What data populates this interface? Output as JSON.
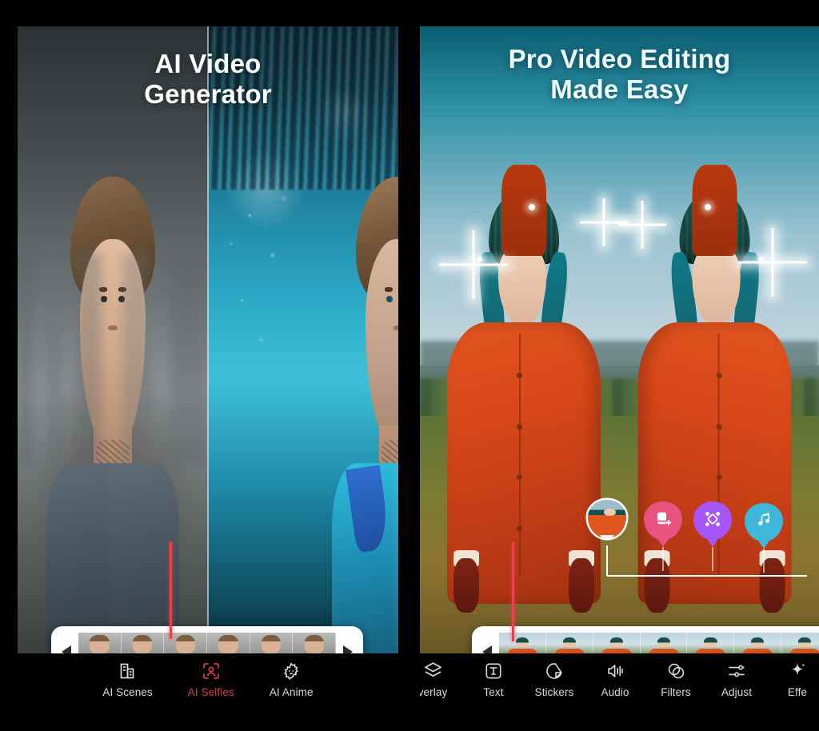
{
  "app": {
    "theme_background": "#000000",
    "accent_active": "#e0384a"
  },
  "left_panel": {
    "headline_line1": "AI Video",
    "headline_line2": "Generator",
    "preview": {
      "split_view": "before-after",
      "before_label": "original",
      "after_label": "ai-enhanced"
    },
    "timeline": {
      "prev_arrow": "◀",
      "next_arrow": "▶",
      "frame_count": 6,
      "playhead_color": "#e8424f"
    },
    "nav": {
      "items": [
        {
          "label": "AI Scenes",
          "icon": "buildings-icon",
          "active": false
        },
        {
          "label": "AI Selfies",
          "icon": "face-scan-icon",
          "active": true
        },
        {
          "label": "AI Anime",
          "icon": "anime-face-icon",
          "active": false
        }
      ]
    }
  },
  "right_panel": {
    "headline_line1": "Pro Video Editing",
    "headline_line2": "Made Easy",
    "preview": {
      "effect": "mirror",
      "subject": "person in orange coat with teal beanie",
      "sparkle_count": 4
    },
    "pins": [
      {
        "name": "clip-thumbnail-pin",
        "icon": "video-thumbnail",
        "color": "#f3f3f3"
      },
      {
        "name": "add-media-pin",
        "icon": "add-image-icon",
        "color": "#e8537f"
      },
      {
        "name": "keyframe-pin",
        "icon": "diamond-nodes-icon",
        "color": "#a855f7"
      },
      {
        "name": "music-pin",
        "icon": "music-notes-icon",
        "color": "#3db8d8"
      }
    ],
    "timeline": {
      "prev_arrow": "◀",
      "frame_count": 7,
      "playhead_color": "#e8424f"
    },
    "nav": {
      "items": [
        {
          "label": "verlay",
          "full_label": "Overlay",
          "icon": "layers-icon",
          "clipped": "left"
        },
        {
          "label": "Text",
          "icon": "text-box-icon",
          "clipped": "none"
        },
        {
          "label": "Stickers",
          "icon": "sticker-icon",
          "clipped": "none"
        },
        {
          "label": "Audio",
          "icon": "speaker-icon",
          "clipped": "none"
        },
        {
          "label": "Filters",
          "icon": "filters-circles-icon",
          "clipped": "none"
        },
        {
          "label": "Adjust",
          "icon": "sliders-icon",
          "clipped": "none"
        },
        {
          "label": "Effe",
          "full_label": "Effects",
          "icon": "sparkle-icon",
          "clipped": "right"
        }
      ]
    }
  }
}
